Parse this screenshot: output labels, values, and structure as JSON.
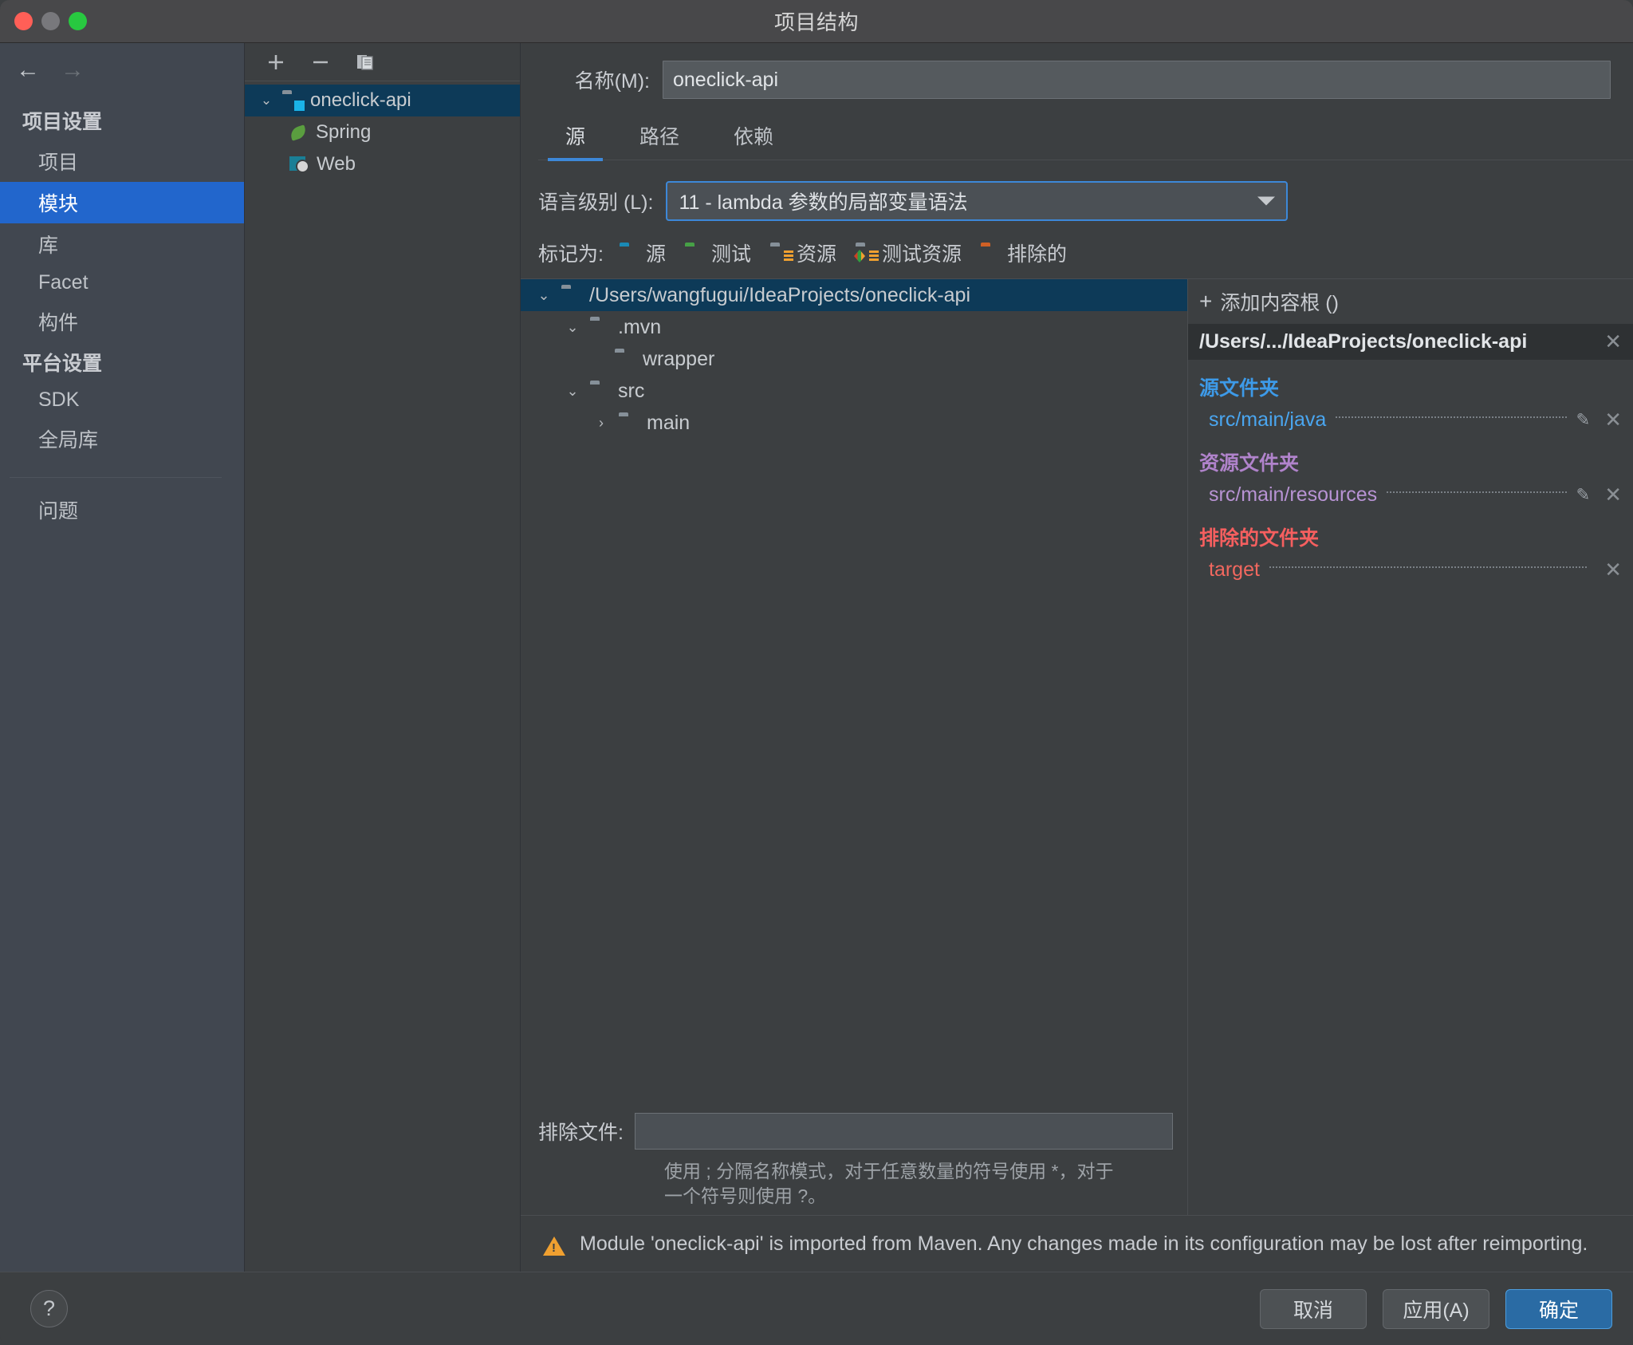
{
  "window": {
    "title": "项目结构"
  },
  "sidebar": {
    "back_icon": "←",
    "forward_icon": "→",
    "groups": [
      {
        "label": "项目设置",
        "items": [
          {
            "label": "项目",
            "selected": false
          },
          {
            "label": "模块",
            "selected": true
          },
          {
            "label": "库",
            "selected": false
          },
          {
            "label": "Facet",
            "selected": false
          },
          {
            "label": "构件",
            "selected": false
          }
        ]
      },
      {
        "label": "平台设置",
        "items": [
          {
            "label": "SDK",
            "selected": false
          },
          {
            "label": "全局库",
            "selected": false
          }
        ]
      }
    ],
    "extra": [
      {
        "label": "问题"
      }
    ]
  },
  "module_panel": {
    "toolbar": {
      "add": "+",
      "remove": "−",
      "copy": "copy-icon"
    },
    "tree": [
      {
        "label": "oneclick-api",
        "icon": "module-folder-icon",
        "chevron": "⌄",
        "selected": true,
        "indent": 0
      },
      {
        "label": "Spring",
        "icon": "spring-leaf-icon",
        "chevron": "",
        "selected": false,
        "indent": 1
      },
      {
        "label": "Web",
        "icon": "web-icon",
        "chevron": "",
        "selected": false,
        "indent": 1
      }
    ]
  },
  "main": {
    "name_label": "名称(M):",
    "name_value": "oneclick-api",
    "tabs": [
      {
        "label": "源",
        "active": true
      },
      {
        "label": "路径",
        "active": false
      },
      {
        "label": "依赖",
        "active": false
      }
    ],
    "language_level": {
      "label": "语言级别 (L):",
      "value": "11 - lambda 参数的局部变量语法"
    },
    "mark_as": {
      "label": "标记为:",
      "options": [
        {
          "label": "源",
          "color": "#1a8ab5",
          "style": "plain"
        },
        {
          "label": "测试",
          "color": "#46a046",
          "style": "plain"
        },
        {
          "label": "资源",
          "color": "#869099",
          "style": "stripes"
        },
        {
          "label": "测试资源",
          "color": "#869099",
          "style": "tricolor"
        },
        {
          "label": "排除的",
          "color": "#cf6025",
          "style": "plain"
        }
      ]
    },
    "file_tree": [
      {
        "label": "/Users/wangfugui/IdeaProjects/oneclick-api",
        "chevron": "⌄",
        "depth": 0,
        "selected": true
      },
      {
        "label": ".mvn",
        "chevron": "⌄",
        "depth": 1,
        "selected": false
      },
      {
        "label": "wrapper",
        "chevron": "",
        "depth": 2,
        "selected": false
      },
      {
        "label": "src",
        "chevron": "⌄",
        "depth": 1,
        "selected": false
      },
      {
        "label": "main",
        "chevron": "›",
        "depth": 2,
        "selected": false
      }
    ],
    "exclude_files": {
      "label": "排除文件:",
      "value": "",
      "hint": "使用 ; 分隔名称模式，对于任意数量的符号使用 *，对于一个符号则使用 ?。"
    },
    "warning": "Module 'oneclick-api' is imported from Maven. Any changes made in its configuration may be lost after reimporting."
  },
  "content_roots": {
    "add_label": "添加内容根 ()",
    "root_path": "/Users/.../IdeaProjects/oneclick-api",
    "groups": [
      {
        "title": "源文件夹",
        "kind": "source",
        "items": [
          {
            "path": "src/main/java",
            "editable": true
          }
        ]
      },
      {
        "title": "资源文件夹",
        "kind": "resource",
        "items": [
          {
            "path": "src/main/resources",
            "editable": true
          }
        ]
      },
      {
        "title": "排除的文件夹",
        "kind": "excluded",
        "items": [
          {
            "path": "target",
            "editable": false
          }
        ]
      }
    ]
  },
  "footer": {
    "help": "?",
    "cancel": "取消",
    "apply": "应用(A)",
    "ok": "确定"
  },
  "colors": {
    "accent": "#3d88d8",
    "selection": "#2266cc",
    "tree_selection": "#0d3a58",
    "source": "#3d9ae8",
    "resource": "#b083cb",
    "excluded": "#f55f5f",
    "warning": "#f0a030",
    "primary_button": "#2a6ba4"
  }
}
